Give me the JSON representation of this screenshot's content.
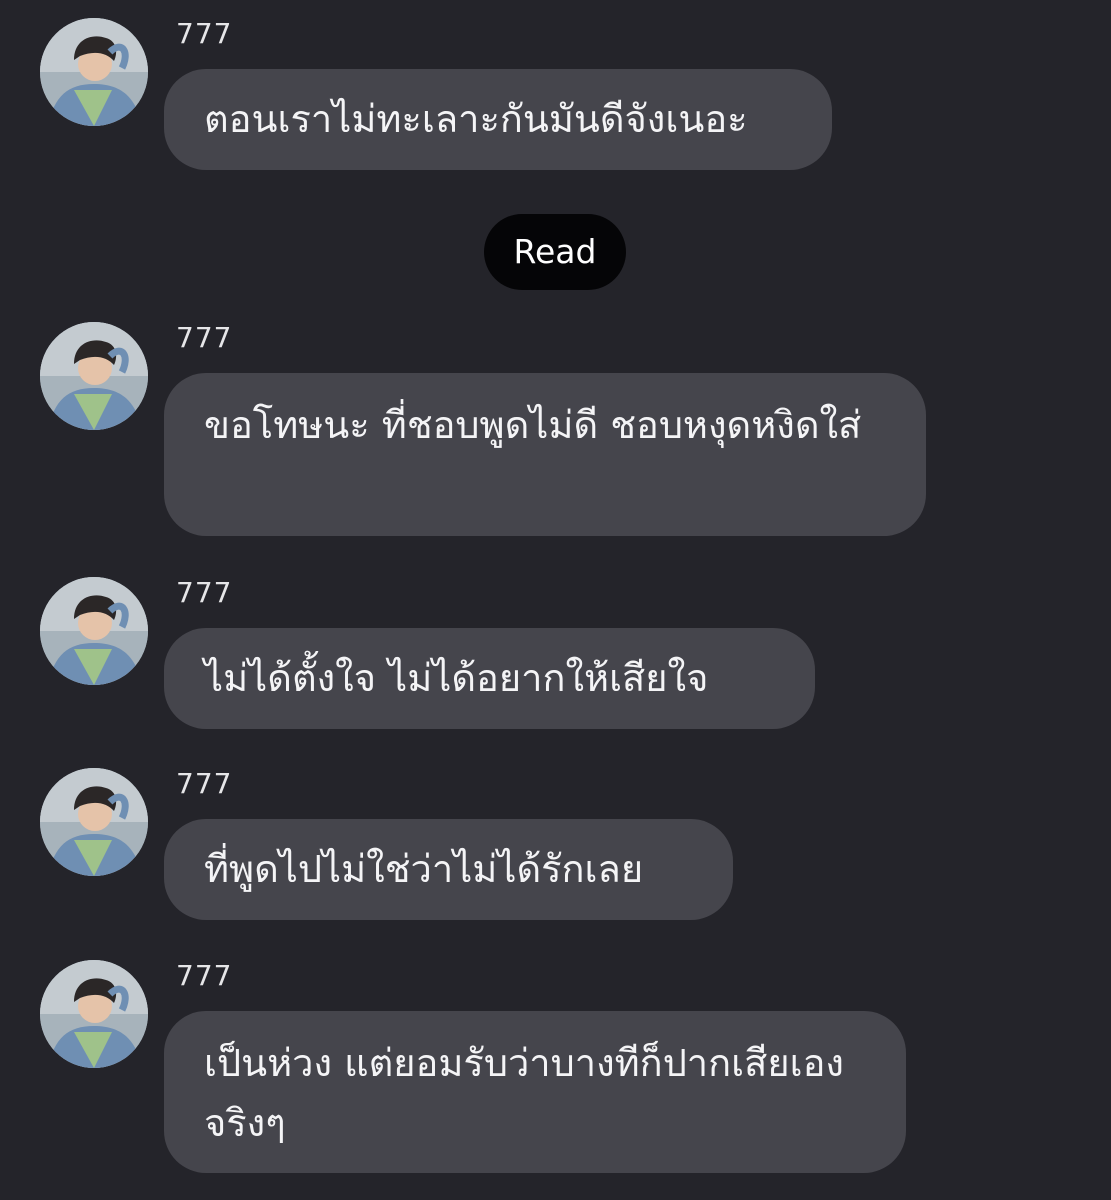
{
  "conversation": {
    "status_label": "Read",
    "messages": [
      {
        "sender": "777",
        "avatar_icon": "profile-photo-icon",
        "text": "ตอนเราไม่ทะเลาะกันมันดีจังเนอะ"
      },
      {
        "sender": "777",
        "avatar_icon": "profile-photo-icon",
        "text": "ขอโทษนะ ที่ชอบพูดไม่ดี ชอบหงุดหงิดใส่"
      },
      {
        "sender": "777",
        "avatar_icon": "profile-photo-icon",
        "text": "ไม่ได้ตั้งใจ ไม่ได้อยากให้เสียใจ"
      },
      {
        "sender": "777",
        "avatar_icon": "profile-photo-icon",
        "text": "ที่พูดไปไม่ใช่ว่าไม่ได้รักเลย"
      },
      {
        "sender": "777",
        "avatar_icon": "profile-photo-icon",
        "text": "เป็นห่วง แต่ยอมรับว่าบางทีก็ปากเสียเองจริงๆ"
      }
    ]
  },
  "colors": {
    "background": "#24242a",
    "bubble": "#45454c",
    "text": "#f4f4f6",
    "read_pill": "#050507"
  }
}
